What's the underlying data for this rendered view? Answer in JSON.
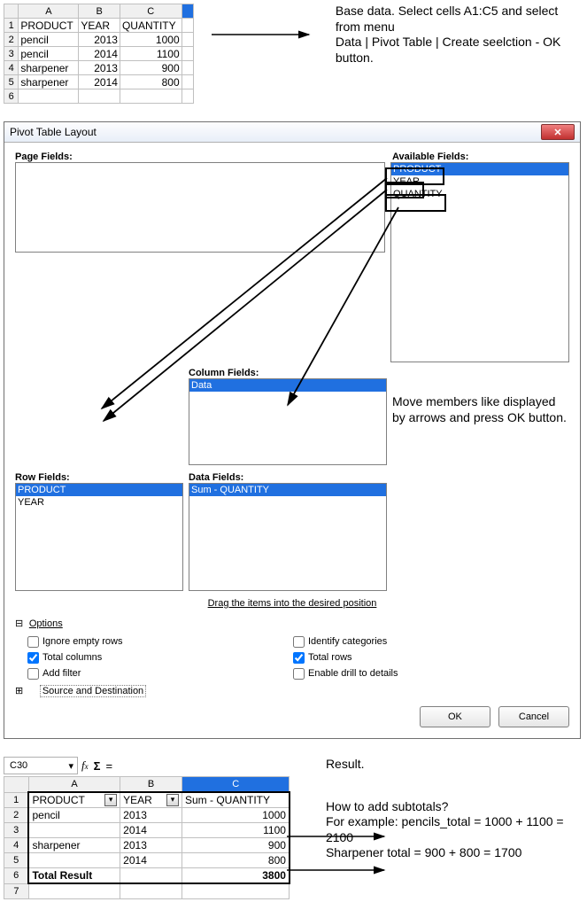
{
  "notes": {
    "top": "Base data. Select cells A1:C5 and select from menu\nData | Pivot Table | Create seelction -  OK button.",
    "move": "Move members like displayed by arrows and press OK button.",
    "result_label": "Result.",
    "subtotals": "How to add subtotals?\nFor example: pencils_total = 1000 + 1100 = 2100",
    "sharp": "Sharpener total = 900 + 800 = 1700"
  },
  "source_table": {
    "columns": [
      "A",
      "B",
      "C"
    ],
    "headers": {
      "A": "PRODUCT",
      "B": "YEAR",
      "C": "QUANTITY"
    },
    "rows": [
      {
        "A": "pencil",
        "B": "2013",
        "C": "1000"
      },
      {
        "A": "pencil",
        "B": "2014",
        "C": "1100"
      },
      {
        "A": "sharpener",
        "B": "2013",
        "C": "900"
      },
      {
        "A": "sharpener",
        "B": "2014",
        "C": "800"
      }
    ]
  },
  "dialog": {
    "title": "Pivot Table Layout",
    "labels": {
      "page_fields": "Page Fields:",
      "available_fields": "Available Fields:",
      "column_fields": "Column Fields:",
      "row_fields": "Row Fields:",
      "data_fields": "Data Fields:",
      "drag_hint": "Drag the items into the desired position",
      "options": "Options",
      "src_dest": "Source and Destination"
    },
    "available": [
      "PRODUCT",
      "YEAR",
      "QUANTITY"
    ],
    "column_fields": [
      "Data"
    ],
    "row_fields": [
      "PRODUCT",
      "YEAR"
    ],
    "data_fields": [
      "Sum - QUANTITY"
    ],
    "checkboxes": {
      "ignore_empty": {
        "label": "Ignore empty rows",
        "checked": false
      },
      "identify_categories": {
        "label": "Identify categories",
        "checked": false
      },
      "total_columns": {
        "label": "Total columns",
        "checked": true
      },
      "total_rows": {
        "label": "Total rows",
        "checked": true
      },
      "add_filter": {
        "label": "Add filter",
        "checked": false
      },
      "enable_drill": {
        "label": "Enable drill to details",
        "checked": false
      }
    },
    "buttons": {
      "ok": "OK",
      "cancel": "Cancel"
    }
  },
  "result": {
    "namebox": "C30",
    "columns": [
      "A",
      "B",
      "C"
    ],
    "headers": {
      "A": "PRODUCT",
      "B": "YEAR",
      "C": "Sum - QUANTITY"
    },
    "rows": [
      {
        "A": "pencil",
        "B": "2013",
        "C": "1000"
      },
      {
        "A": "",
        "B": "2014",
        "C": "1100"
      },
      {
        "A": "sharpener",
        "B": "2013",
        "C": "900"
      },
      {
        "A": "",
        "B": "2014",
        "C": "800"
      }
    ],
    "total_label": "Total Result",
    "total_value": "3800"
  }
}
